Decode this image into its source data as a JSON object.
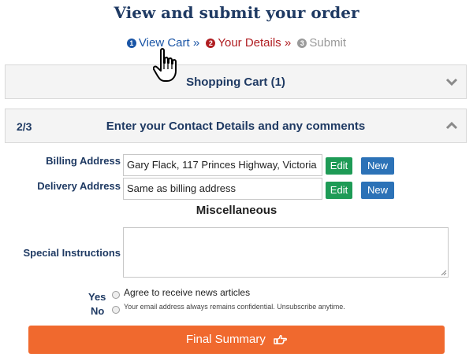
{
  "page": {
    "title": "View and submit your order"
  },
  "steps": [
    {
      "num": "1",
      "label": "View Cart »",
      "color": "#1a55a6"
    },
    {
      "num": "2",
      "label": "Your Details »",
      "color": "#b01e22"
    },
    {
      "num": "3",
      "label": "Submit",
      "color": "#9a9a9a"
    }
  ],
  "cart_panel": {
    "title": "Shopping Cart (1)",
    "icon": "chevron-down-icon"
  },
  "contact_panel": {
    "step": "2/3",
    "title": "Enter your Contact Details and any comments",
    "icon": "chevron-up-icon"
  },
  "billing": {
    "label": "Billing Address",
    "value": "Gary Flack, 117 Princes Highway, Victoria",
    "edit": "Edit",
    "new": "New"
  },
  "delivery": {
    "label": "Delivery Address",
    "value": "Same as billing address",
    "edit": "Edit",
    "new": "New"
  },
  "misc": {
    "heading": "Miscellaneous"
  },
  "special": {
    "label": "Special Instructions",
    "value": ""
  },
  "news": {
    "yes_label": "Yes",
    "no_label": "No",
    "agree_text": "Agree to receive news articles",
    "note": "Your email address always remains confidential. Unsubscribe anytime."
  },
  "final_button": {
    "label": "Final Summary",
    "icon": "hand-point-right-icon"
  },
  "colors": {
    "accent": "#f0692e",
    "edit": "#1e9b56",
    "new": "#2c72b7",
    "heading": "#1f3a63"
  }
}
